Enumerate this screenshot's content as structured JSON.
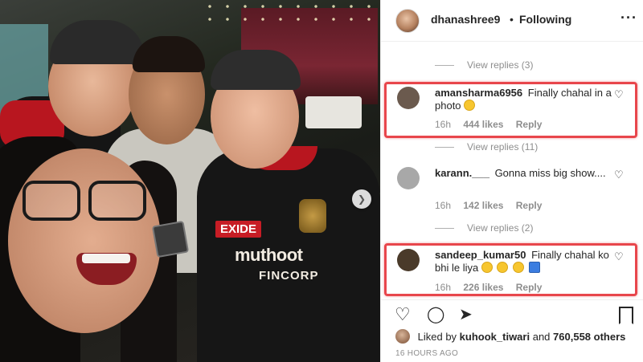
{
  "post_header": {
    "username": "dhanashree9",
    "separator": "•",
    "follow_status": "Following",
    "more_icon": "more-horizontal-icon"
  },
  "photo": {
    "jersey_sponsor": "muthoot",
    "jersey_sponsor_sub": "FINCORP",
    "sleeve_sponsor": "EXIDE",
    "next_icon": "chevron-right-icon"
  },
  "comments": {
    "top_view_replies": "View replies (3)",
    "items": [
      {
        "username": "amansharma6956",
        "text": "Finally chahal in a photo",
        "emojis": [
          "grinning-face"
        ],
        "time": "16h",
        "likes": "444 likes",
        "reply_label": "Reply",
        "view_replies": "View replies (11)",
        "avatar_color": "#6b5a4e"
      },
      {
        "username": "karann.___",
        "text": "Gonna miss big show....",
        "emojis": [],
        "time": "16h",
        "likes": "142 likes",
        "reply_label": "Reply",
        "view_replies": "View replies (2)",
        "avatar_color": "#a8a8a8"
      },
      {
        "username": "sandeep_kumar50",
        "text": "Finally chahal ko bhi le liya",
        "emojis": [
          "laughing-face",
          "laughing-face",
          "rofl-face",
          "play-reverse"
        ],
        "time": "16h",
        "likes": "226 likes",
        "reply_label": "Reply",
        "avatar_color": "#4a3a2a"
      }
    ],
    "highlight_color": "#e8464c"
  },
  "actions": {
    "like_icon": "heart-icon",
    "comment_icon": "comment-icon",
    "share_icon": "send-icon",
    "save_icon": "bookmark-icon"
  },
  "likes_summary": {
    "prefix": "Liked by",
    "liker": "kuhook_tiwari",
    "middle": "and",
    "others": "760,558 others"
  },
  "timestamp": "16 HOURS AGO"
}
